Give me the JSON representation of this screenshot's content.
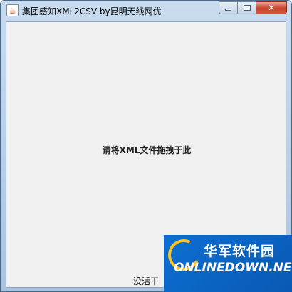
{
  "window": {
    "title": "集团感知XML2CSV by昆明无线网优",
    "app_icon_glyph": "☕",
    "controls": {
      "minimize": "",
      "maximize": "",
      "close": "✕"
    }
  },
  "main": {
    "drop_hint": "请将XML文件拖拽于此",
    "status": "没活干"
  },
  "watermark": {
    "cn": "华军软件园",
    "en": "ONLINEDOWN.NET"
  },
  "colors": {
    "titlebar": "#b8cfe6",
    "client": "#f0f0f0",
    "close_button": "#c8432a",
    "watermark_bg": "#0c6fd1",
    "watermark_ring": "#ffc21a"
  }
}
